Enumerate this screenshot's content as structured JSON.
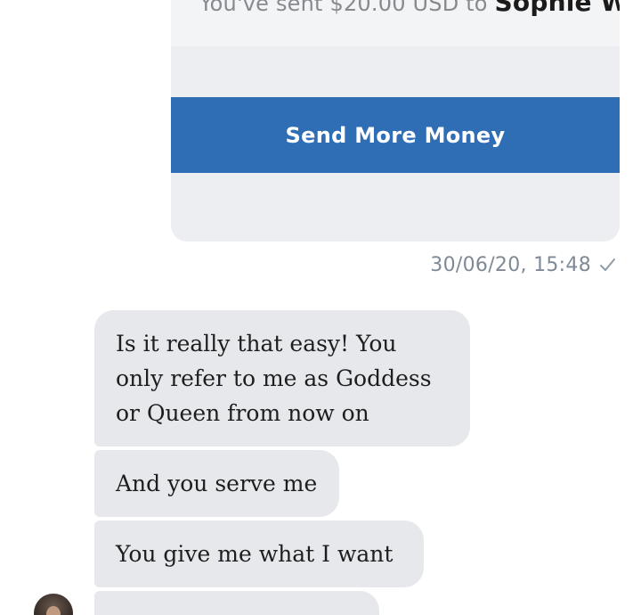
{
  "payment": {
    "sent_text": "You've sent $20.00 USD to",
    "recipient": "Sophie West",
    "button_label": "Send More Money"
  },
  "message_meta": {
    "timestamp": "30/06/20, 15:48",
    "status_icon": "single-check-icon"
  },
  "incoming_messages": [
    "Is it really that easy! You\nonly refer to me as Goddess\nor Queen from now on",
    "And you serve me",
    "You give me what I want",
    ""
  ],
  "colors": {
    "button": "#2f6db5",
    "card": "#eceef1",
    "incoming_bubble": "#e6e8ec",
    "timestamp": "#7e8a95"
  }
}
